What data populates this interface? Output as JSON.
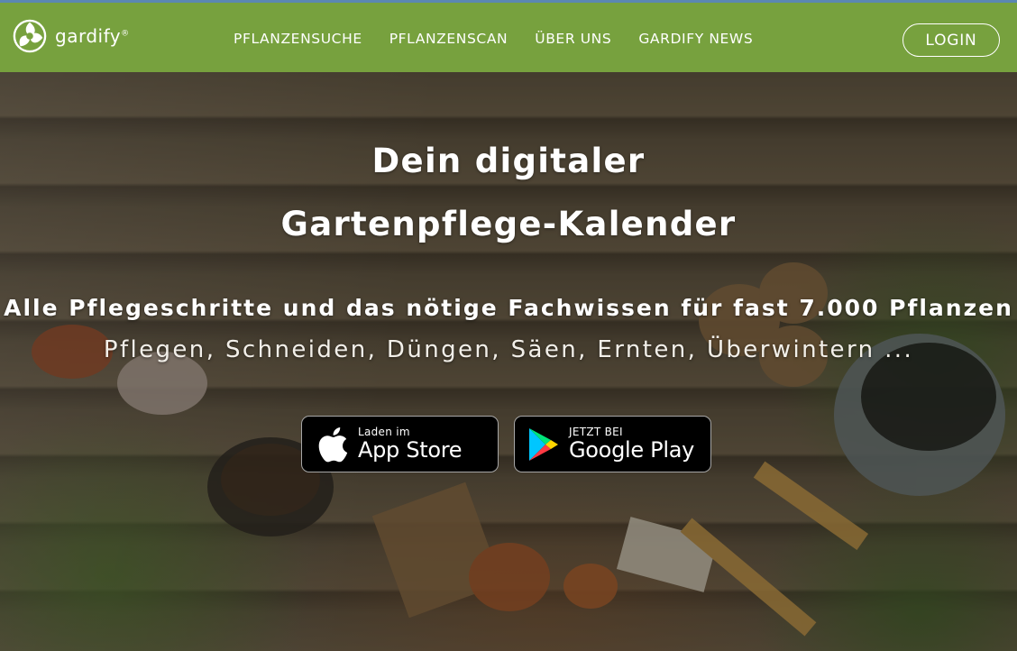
{
  "header": {
    "logo_text": "gardify",
    "logo_mark": "®",
    "nav": [
      "PFLANZENSUCHE",
      "PFLANZENSCAN",
      "ÜBER UNS",
      "GARDIFY NEWS"
    ],
    "login_label": "LOGIN"
  },
  "hero": {
    "title_line1": "Dein digitaler",
    "title_line2": "Gartenpflege-Kalender",
    "subtitle": "Alle Pflegeschritte und das nötige Fachwissen für fast 7.000 Pflanzen",
    "tasks": "Pflegen, Schneiden, Düngen, Säen, Ernten, Überwintern ..."
  },
  "badges": {
    "appstore": {
      "small": "Laden im",
      "big": "App Store",
      "icon": "apple-icon"
    },
    "googleplay": {
      "small": "JETZT BEI",
      "big": "Google Play",
      "icon": "google-play-icon"
    }
  },
  "colors": {
    "navbar": "#77a13e",
    "topline": "#5b87b3",
    "text": "#ffffff"
  }
}
